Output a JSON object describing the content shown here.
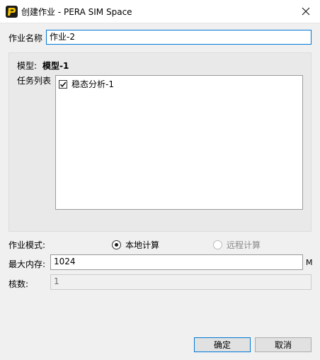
{
  "window": {
    "title": "创建作业 - PERA SIM Space"
  },
  "form": {
    "job_name_label": "作业名称",
    "job_name_value": "作业-2",
    "model_label": "模型:",
    "model_value": "模型-1",
    "task_list_label": "任务列表",
    "tasks": [
      {
        "label": "稳态分析-1",
        "checked": true
      }
    ],
    "job_mode_label": "作业模式:",
    "mode_local": "本地计算",
    "mode_remote": "远程计算",
    "max_memory_label": "最大内存:",
    "max_memory_value": "1024",
    "memory_unit": "M",
    "cores_label": "核数:",
    "cores_value": "1"
  },
  "buttons": {
    "ok": "确定",
    "cancel": "取消"
  }
}
